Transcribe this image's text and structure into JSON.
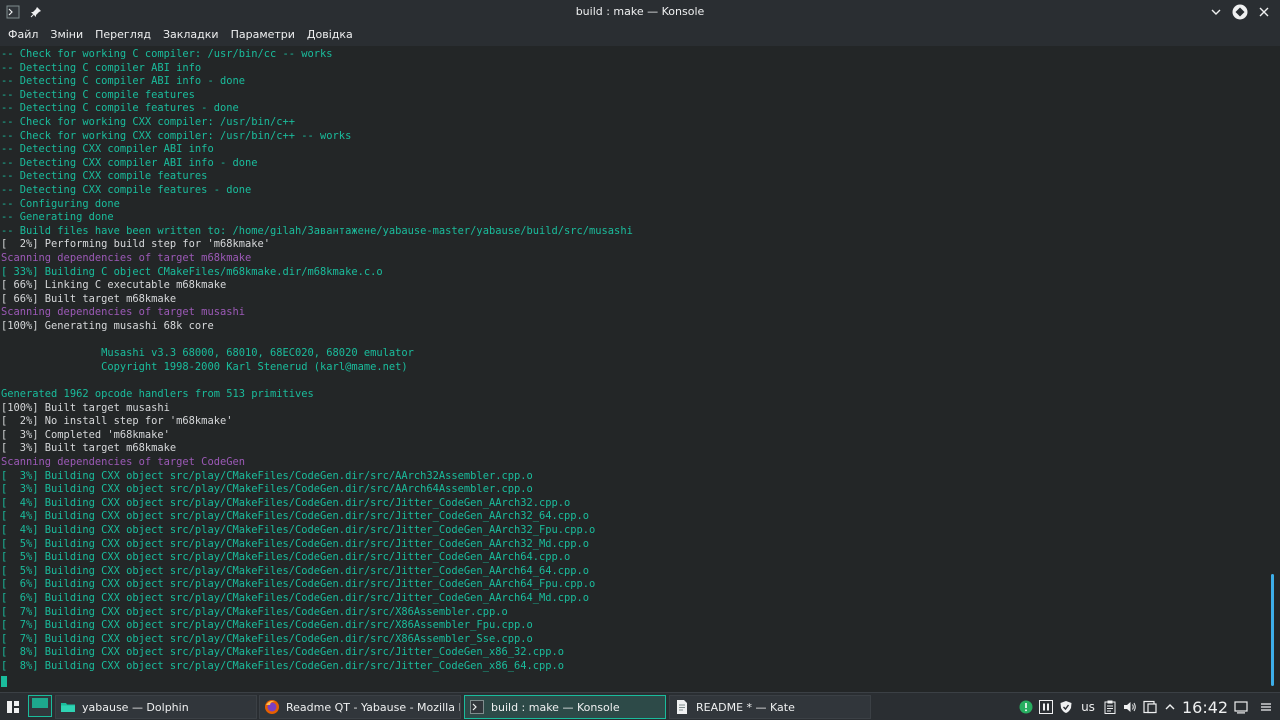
{
  "window": {
    "title": "build : make — Konsole"
  },
  "menu": [
    "Файл",
    "Зміни",
    "Перегляд",
    "Закладки",
    "Параметри",
    "Довідка"
  ],
  "terminal": {
    "lines": [
      {
        "text": "-- Check for working C compiler: /usr/bin/cc -- works",
        "color": "teal"
      },
      {
        "text": "-- Detecting C compiler ABI info",
        "color": "teal"
      },
      {
        "text": "-- Detecting C compiler ABI info - done",
        "color": "teal"
      },
      {
        "text": "-- Detecting C compile features",
        "color": "teal"
      },
      {
        "text": "-- Detecting C compile features - done",
        "color": "teal"
      },
      {
        "text": "-- Check for working CXX compiler: /usr/bin/c++",
        "color": "teal"
      },
      {
        "text": "-- Check for working CXX compiler: /usr/bin/c++ -- works",
        "color": "teal"
      },
      {
        "text": "-- Detecting CXX compiler ABI info",
        "color": "teal"
      },
      {
        "text": "-- Detecting CXX compiler ABI info - done",
        "color": "teal"
      },
      {
        "text": "-- Detecting CXX compile features",
        "color": "teal"
      },
      {
        "text": "-- Detecting CXX compile features - done",
        "color": "teal"
      },
      {
        "text": "-- Configuring done",
        "color": "teal"
      },
      {
        "text": "-- Generating done",
        "color": "teal"
      },
      {
        "text": "-- Build files have been written to: /home/gilah/Завантажене/yabause-master/yabause/build/src/musashi",
        "color": "teal"
      },
      {
        "text": "[  2%] Performing build step for 'm68kmake'",
        "color": "white"
      },
      {
        "text": "Scanning dependencies of target m68kmake",
        "color": "purple"
      },
      {
        "text": "[ 33%] Building C object CMakeFiles/m68kmake.dir/m68kmake.c.o",
        "color": "teal"
      },
      {
        "text": "[ 66%] Linking C executable m68kmake",
        "color": "white"
      },
      {
        "text": "[ 66%] Built target m68kmake",
        "color": "white"
      },
      {
        "text": "Scanning dependencies of target musashi",
        "color": "purple"
      },
      {
        "text": "[100%] Generating musashi 68k core",
        "color": "white"
      },
      {
        "text": "",
        "color": "teal"
      },
      {
        "text": "                Musashi v3.3 68000, 68010, 68EC020, 68020 emulator",
        "color": "teal"
      },
      {
        "text": "                Copyright 1998-2000 Karl Stenerud (karl@mame.net)",
        "color": "teal"
      },
      {
        "text": "",
        "color": "teal"
      },
      {
        "text": "Generated 1962 opcode handlers from 513 primitives",
        "color": "teal"
      },
      {
        "text": "[100%] Built target musashi",
        "color": "white"
      },
      {
        "text": "[  2%] No install step for 'm68kmake'",
        "color": "white"
      },
      {
        "text": "[  3%] Completed 'm68kmake'",
        "color": "white"
      },
      {
        "text": "[  3%] Built target m68kmake",
        "color": "white"
      },
      {
        "text": "Scanning dependencies of target CodeGen",
        "color": "purple"
      },
      {
        "text": "[  3%] Building CXX object src/play/CMakeFiles/CodeGen.dir/src/AArch32Assembler.cpp.o",
        "color": "teal"
      },
      {
        "text": "[  3%] Building CXX object src/play/CMakeFiles/CodeGen.dir/src/AArch64Assembler.cpp.o",
        "color": "teal"
      },
      {
        "text": "[  4%] Building CXX object src/play/CMakeFiles/CodeGen.dir/src/Jitter_CodeGen_AArch32.cpp.o",
        "color": "teal"
      },
      {
        "text": "[  4%] Building CXX object src/play/CMakeFiles/CodeGen.dir/src/Jitter_CodeGen_AArch32_64.cpp.o",
        "color": "teal"
      },
      {
        "text": "[  4%] Building CXX object src/play/CMakeFiles/CodeGen.dir/src/Jitter_CodeGen_AArch32_Fpu.cpp.o",
        "color": "teal"
      },
      {
        "text": "[  5%] Building CXX object src/play/CMakeFiles/CodeGen.dir/src/Jitter_CodeGen_AArch32_Md.cpp.o",
        "color": "teal"
      },
      {
        "text": "[  5%] Building CXX object src/play/CMakeFiles/CodeGen.dir/src/Jitter_CodeGen_AArch64.cpp.o",
        "color": "teal"
      },
      {
        "text": "[  5%] Building CXX object src/play/CMakeFiles/CodeGen.dir/src/Jitter_CodeGen_AArch64_64.cpp.o",
        "color": "teal"
      },
      {
        "text": "[  6%] Building CXX object src/play/CMakeFiles/CodeGen.dir/src/Jitter_CodeGen_AArch64_Fpu.cpp.o",
        "color": "teal"
      },
      {
        "text": "[  6%] Building CXX object src/play/CMakeFiles/CodeGen.dir/src/Jitter_CodeGen_AArch64_Md.cpp.o",
        "color": "teal"
      },
      {
        "text": "[  7%] Building CXX object src/play/CMakeFiles/CodeGen.dir/src/X86Assembler.cpp.o",
        "color": "teal"
      },
      {
        "text": "[  7%] Building CXX object src/play/CMakeFiles/CodeGen.dir/src/X86Assembler_Fpu.cpp.o",
        "color": "teal"
      },
      {
        "text": "[  7%] Building CXX object src/play/CMakeFiles/CodeGen.dir/src/X86Assembler_Sse.cpp.o",
        "color": "teal"
      },
      {
        "text": "[  8%] Building CXX object src/play/CMakeFiles/CodeGen.dir/src/Jitter_CodeGen_x86_32.cpp.o",
        "color": "teal"
      },
      {
        "text": "[  8%] Building CXX object src/play/CMakeFiles/CodeGen.dir/src/Jitter_CodeGen_x86_64.cpp.o",
        "color": "teal"
      }
    ]
  },
  "taskbar": {
    "tasks": [
      {
        "label": "yabause — Dolphin",
        "icon": "folder-icon",
        "active": false
      },
      {
        "label": "Readme QT - Yabause - Mozilla Fir...",
        "icon": "firefox-icon",
        "active": false
      },
      {
        "label": "build : make — Konsole",
        "icon": "terminal-icon",
        "active": true
      },
      {
        "label": "README * — Kate",
        "icon": "document-icon",
        "active": false
      }
    ],
    "keyboard_layout": "us",
    "clock": "16:42"
  },
  "colors": {
    "teal": "#1abc9c",
    "purple": "#9b59b6",
    "white": "#d6d8da",
    "accent": "#3daee9"
  }
}
